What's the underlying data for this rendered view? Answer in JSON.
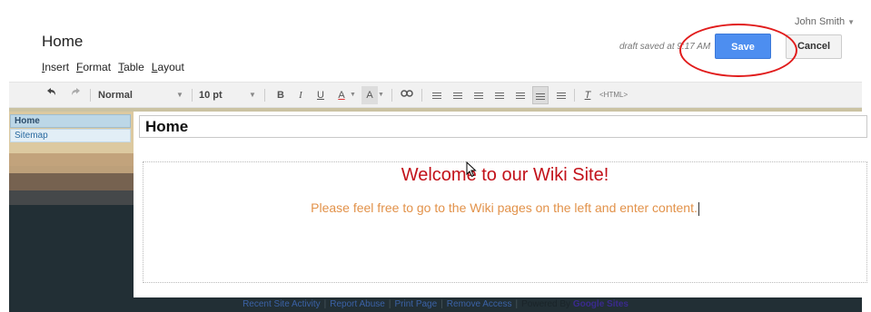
{
  "header": {
    "page_title": "Home",
    "user_name": "John Smith",
    "draft_status": "draft saved at 9:17 AM",
    "save_label": "Save",
    "cancel_label": "Cancel",
    "menus": [
      {
        "label": "Insert",
        "underline": "I",
        "rest": "nsert"
      },
      {
        "label": "Format",
        "underline": "F",
        "rest": "ormat"
      },
      {
        "label": "Table",
        "underline": "T",
        "rest": "able"
      },
      {
        "label": "Layout",
        "underline": "L",
        "rest": "ayout"
      }
    ]
  },
  "toolbar": {
    "style_value": "Normal",
    "size_value": "10 pt",
    "bold": "B",
    "italic": "I",
    "underline": "U",
    "text_color": "A",
    "bg_color": "A",
    "clear_format": "T",
    "html_label": "<HTML>"
  },
  "sidebar": {
    "items": [
      {
        "label": "Home"
      },
      {
        "label": "Sitemap"
      }
    ]
  },
  "content": {
    "page_title_field": "Home",
    "welcome_heading": "Welcome to our Wiki Site!",
    "welcome_message": "Please feel free to go to the Wiki pages on the left and enter content."
  },
  "footer": {
    "links": [
      "Recent Site Activity",
      "Report Abuse",
      "Print Page",
      "Remove Access"
    ],
    "powered_by": "Powered By",
    "brand": "Google Sites"
  },
  "colors": {
    "save_button": "#4d8ef0",
    "annotation_circle": "#e11c1c",
    "heading_red": "#c2121a",
    "message_orange": "#e2924a",
    "sidebar_dark": "#222f35"
  }
}
